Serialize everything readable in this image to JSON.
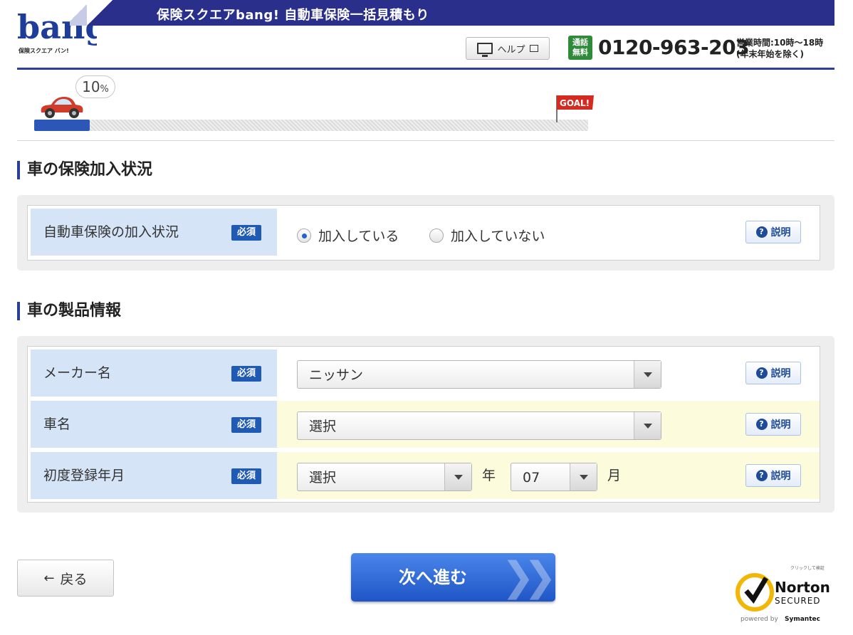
{
  "header": {
    "title": "保険スクエアbang! 自動車保険一括見積もり",
    "logo_text": "bang!",
    "logo_sub": "保険スクエア バン!",
    "help_label": "ヘルプ",
    "tel_badge": "通話無料",
    "tel_number": "0120-963-203",
    "hours_line1": "営業時間:10時～18時",
    "hours_line2": "(年末年始を除く)"
  },
  "progress": {
    "percent_value": 10,
    "percent_label": "10",
    "percent_unit": "%",
    "goal_label": "GOAL!"
  },
  "section1": {
    "title": "車の保険加入状況",
    "row": {
      "label": "自動車保険の加入状況",
      "required": "必須",
      "option_yes": "加入している",
      "option_no": "加入していない",
      "selected": "加入している",
      "help": "説明"
    }
  },
  "section2": {
    "title": "車の製品情報",
    "maker": {
      "label": "メーカー名",
      "required": "必須",
      "value": "ニッサン",
      "help": "説明"
    },
    "car": {
      "label": "車名",
      "required": "必須",
      "value": "選択",
      "help": "説明"
    },
    "reg": {
      "label": "初度登録年月",
      "required": "必須",
      "year_value": "選択",
      "year_unit": "年",
      "month_value": "07",
      "month_unit": "月",
      "help": "説明"
    }
  },
  "buttons": {
    "back": "戻る",
    "next": "次へ進む"
  },
  "norton": {
    "top_text": "クリックして検証",
    "brand": "Norton",
    "secured": "SECURED",
    "powered": "powered by",
    "symantec": "Symantec"
  },
  "colors": {
    "brand_navy": "#2b2f8c",
    "accent_blue": "#1f5ab4",
    "label_bg": "#d6e4f7",
    "highlight_bg": "#fcfbdc"
  }
}
